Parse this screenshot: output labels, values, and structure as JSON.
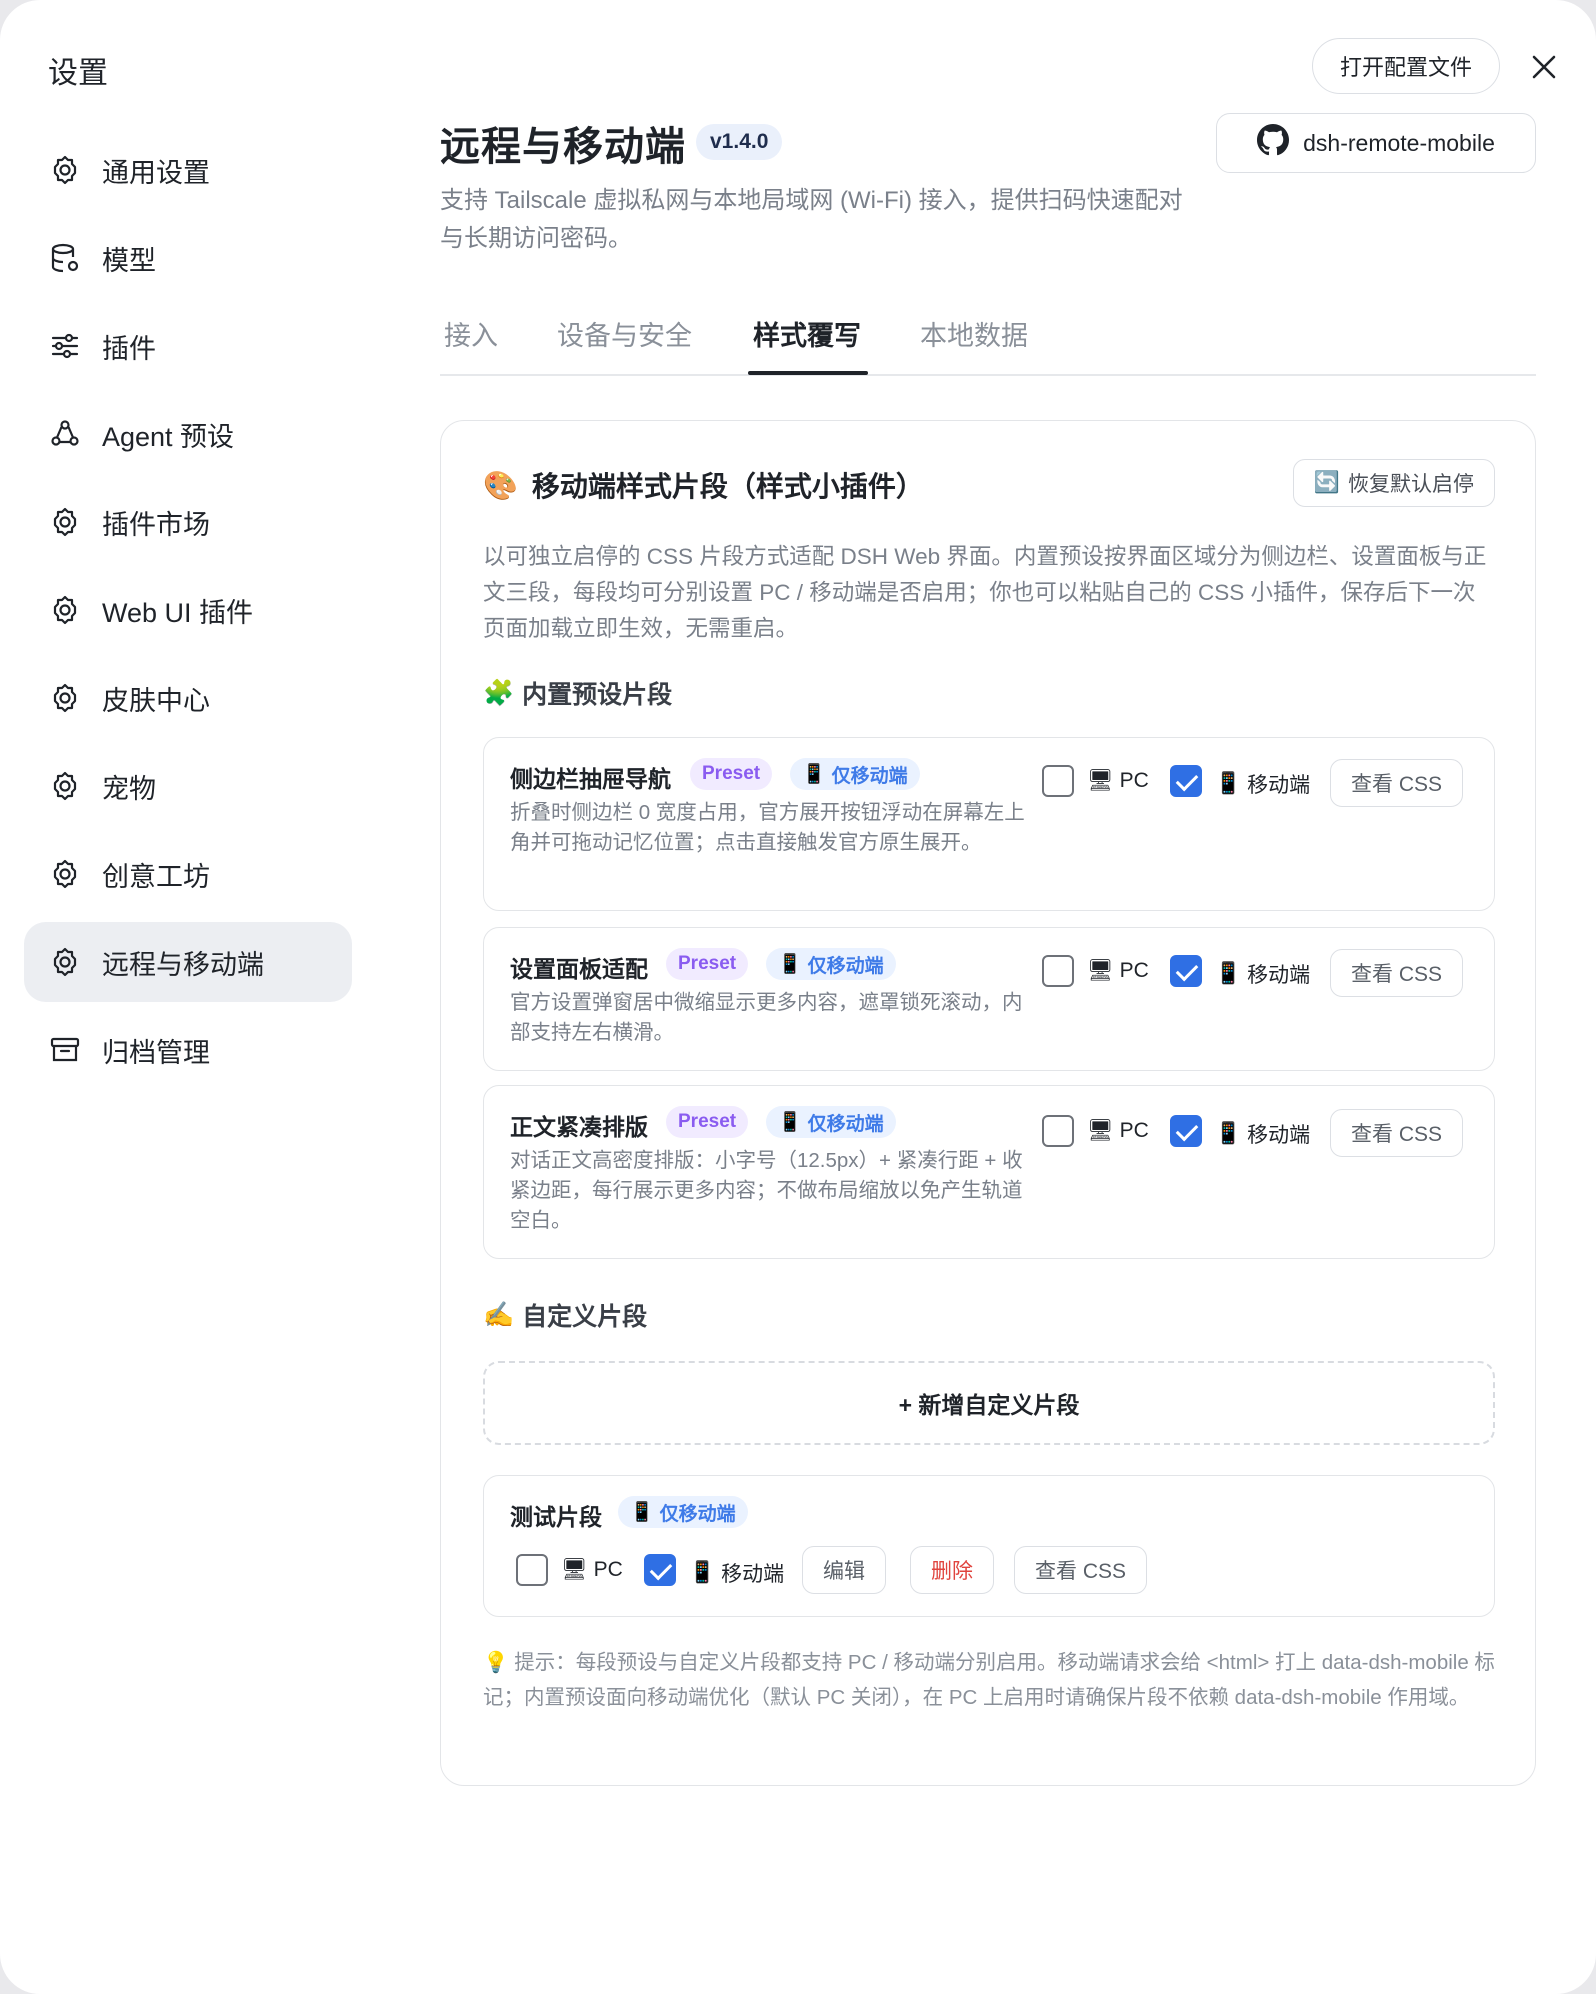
{
  "window": {
    "title": "设置",
    "open_config_label": "打开配置文件"
  },
  "sidebar": {
    "items": [
      {
        "label": "通用设置",
        "icon": "gear-icon"
      },
      {
        "label": "模型",
        "icon": "database-gear-icon"
      },
      {
        "label": "插件",
        "icon": "sliders-icon"
      },
      {
        "label": "Agent 预设",
        "icon": "agent-nodes-icon"
      },
      {
        "label": "插件市场",
        "icon": "gear-icon"
      },
      {
        "label": "Web UI 插件",
        "icon": "gear-icon"
      },
      {
        "label": "皮肤中心",
        "icon": "gear-icon"
      },
      {
        "label": "宠物",
        "icon": "gear-icon"
      },
      {
        "label": "创意工坊",
        "icon": "gear-icon"
      },
      {
        "label": "远程与移动端",
        "icon": "gear-icon",
        "active": true
      },
      {
        "label": "归档管理",
        "icon": "archive-icon"
      }
    ]
  },
  "page": {
    "title": "远程与移动端",
    "version": "v1.4.0",
    "repo_label": "dsh-remote-mobile",
    "description": "支持 Tailscale 虚拟私网与本地局域网 (Wi-Fi) 接入，提供扫码快速配对与长期访问密码。"
  },
  "tabs": [
    {
      "label": "接入"
    },
    {
      "label": "设备与安全"
    },
    {
      "label": "样式覆写",
      "active": true
    },
    {
      "label": "本地数据"
    }
  ],
  "style_section": {
    "emoji": "🎨",
    "title": "移动端样式片段（样式小插件）",
    "reset_label": "恢复默认启停",
    "reset_emoji": "🔄",
    "description": "以可独立启停的 CSS 片段方式适配 DSH Web 界面。内置预设按界面区域分为侧边栏、设置面板与正文三段，每段均可分别设置 PC / 移动端是否启用；你也可以粘贴自己的 CSS 小插件，保存后下一次页面加载立即生效，无需重启。",
    "builtin_emoji": "🧩",
    "builtin_title": "内置预设片段",
    "presets": [
      {
        "name": "侧边栏抽屉导航",
        "preset_tag": "Preset",
        "mobile_tag": "仅移动端",
        "description": "折叠时侧边栏 0 宽度占用，官方展开按钮浮动在屏幕左上角并可拖动记忆位置；点击直接触发官方原生展开。",
        "pc_label": "PC",
        "mobile_label": "移动端",
        "pc_enabled": false,
        "mobile_enabled": true,
        "view_css_label": "查看 CSS"
      },
      {
        "name": "设置面板适配",
        "preset_tag": "Preset",
        "mobile_tag": "仅移动端",
        "description": "官方设置弹窗居中微缩显示更多内容，遮罩锁死滚动，内部支持左右横滑。",
        "pc_label": "PC",
        "mobile_label": "移动端",
        "pc_enabled": false,
        "mobile_enabled": true,
        "view_css_label": "查看 CSS"
      },
      {
        "name": "正文紧凑排版",
        "preset_tag": "Preset",
        "mobile_tag": "仅移动端",
        "description": "对话正文高密度排版：小字号（12.5px）+ 紧凑行距 + 收紧边距，每行展示更多内容；不做布局缩放以免产生轨道空白。",
        "pc_label": "PC",
        "mobile_label": "移动端",
        "pc_enabled": false,
        "mobile_enabled": true,
        "view_css_label": "查看 CSS"
      }
    ],
    "custom_emoji": "✍️",
    "custom_title": "自定义片段",
    "add_custom_label": "+ 新增自定义片段",
    "custom_snippets": [
      {
        "name": "测试片段",
        "mobile_tag": "仅移动端",
        "pc_label": "PC",
        "mobile_label": "移动端",
        "pc_enabled": false,
        "mobile_enabled": true,
        "edit_label": "编辑",
        "delete_label": "删除",
        "view_css_label": "查看 CSS"
      }
    ],
    "tip": "💡 提示：每段预设与自定义片段都支持 PC / 移动端分别启用。移动端请求会给 <html> 打上 data-dsh-mobile 标记；内置预设面向移动端优化（默认 PC 关闭），在 PC 上启用时请确保片段不依赖 data-dsh-mobile 作用域。"
  },
  "emoji": {
    "pc": "🖥",
    "mobile": "📱"
  },
  "colors": {
    "accent": "#2f6fe4",
    "preset_tag": "#8a5cf0",
    "mobile_tag": "#3f7be8",
    "danger": "#e0443e"
  }
}
